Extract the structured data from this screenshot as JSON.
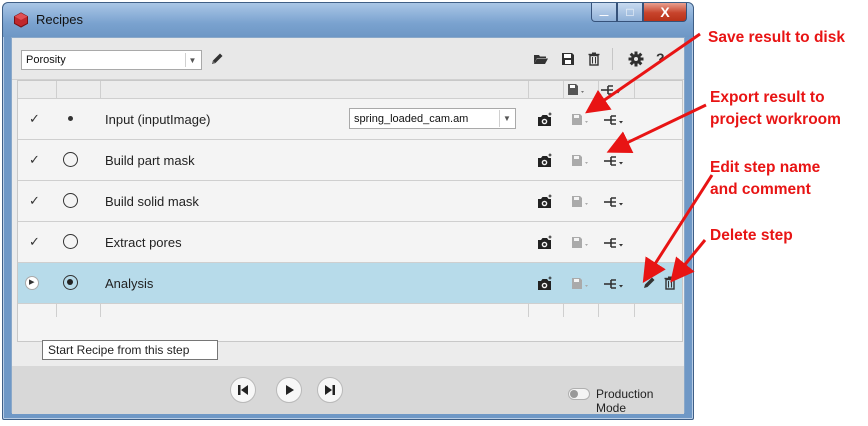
{
  "window": {
    "title": "Recipes",
    "buttons": {
      "minimize": "—",
      "maximize": "□",
      "close": "X"
    }
  },
  "toolbar": {
    "recipe_selector": {
      "value": "Porosity",
      "icon": "chevron-down-icon"
    },
    "icons": [
      "pencil-icon",
      "folder-open-icon",
      "save-icon",
      "trash-icon",
      "gear-icon",
      "help-icon"
    ],
    "help_label": "?"
  },
  "grid": {
    "header_icons": [
      "save-dropdown-icon",
      "export-dropdown-icon"
    ],
    "rows": [
      {
        "status": "✓",
        "label": "Input (inputImage)",
        "input_value": "spring_loaded_cam.am",
        "selected": false
      },
      {
        "status": "✓",
        "label": "Build part mask",
        "selected": false
      },
      {
        "status": "✓",
        "label": "Build solid mask",
        "selected": false
      },
      {
        "status": "✓",
        "label": "Extract pores",
        "selected": false
      },
      {
        "status": "▸",
        "label": "Analysis",
        "selected": true
      }
    ],
    "row_icons": [
      "snapshot-icon",
      "save-dropdown-icon",
      "export-dropdown-icon"
    ],
    "selected_row_extra_icons": [
      "pencil-icon",
      "trash-icon"
    ]
  },
  "tooltip": {
    "text": "Start Recipe from this step"
  },
  "bottom_bar": {
    "nav_icons": [
      "skip-to-start-icon",
      "play-icon",
      "skip-to-end-icon"
    ],
    "production_mode": {
      "label": "Production Mode",
      "enabled": false
    }
  },
  "annotations": {
    "color": "#e81414",
    "items": [
      {
        "text": "Save result to disk"
      },
      {
        "text": "Export result to"
      },
      {
        "text": "project workroom"
      },
      {
        "text": "Edit step name"
      },
      {
        "text": "and comment"
      },
      {
        "text": "Delete step"
      }
    ]
  },
  "colors": {
    "selected_row": "#b7dbea",
    "window_frame": "#6f98c6",
    "annotation": "#e81414"
  }
}
